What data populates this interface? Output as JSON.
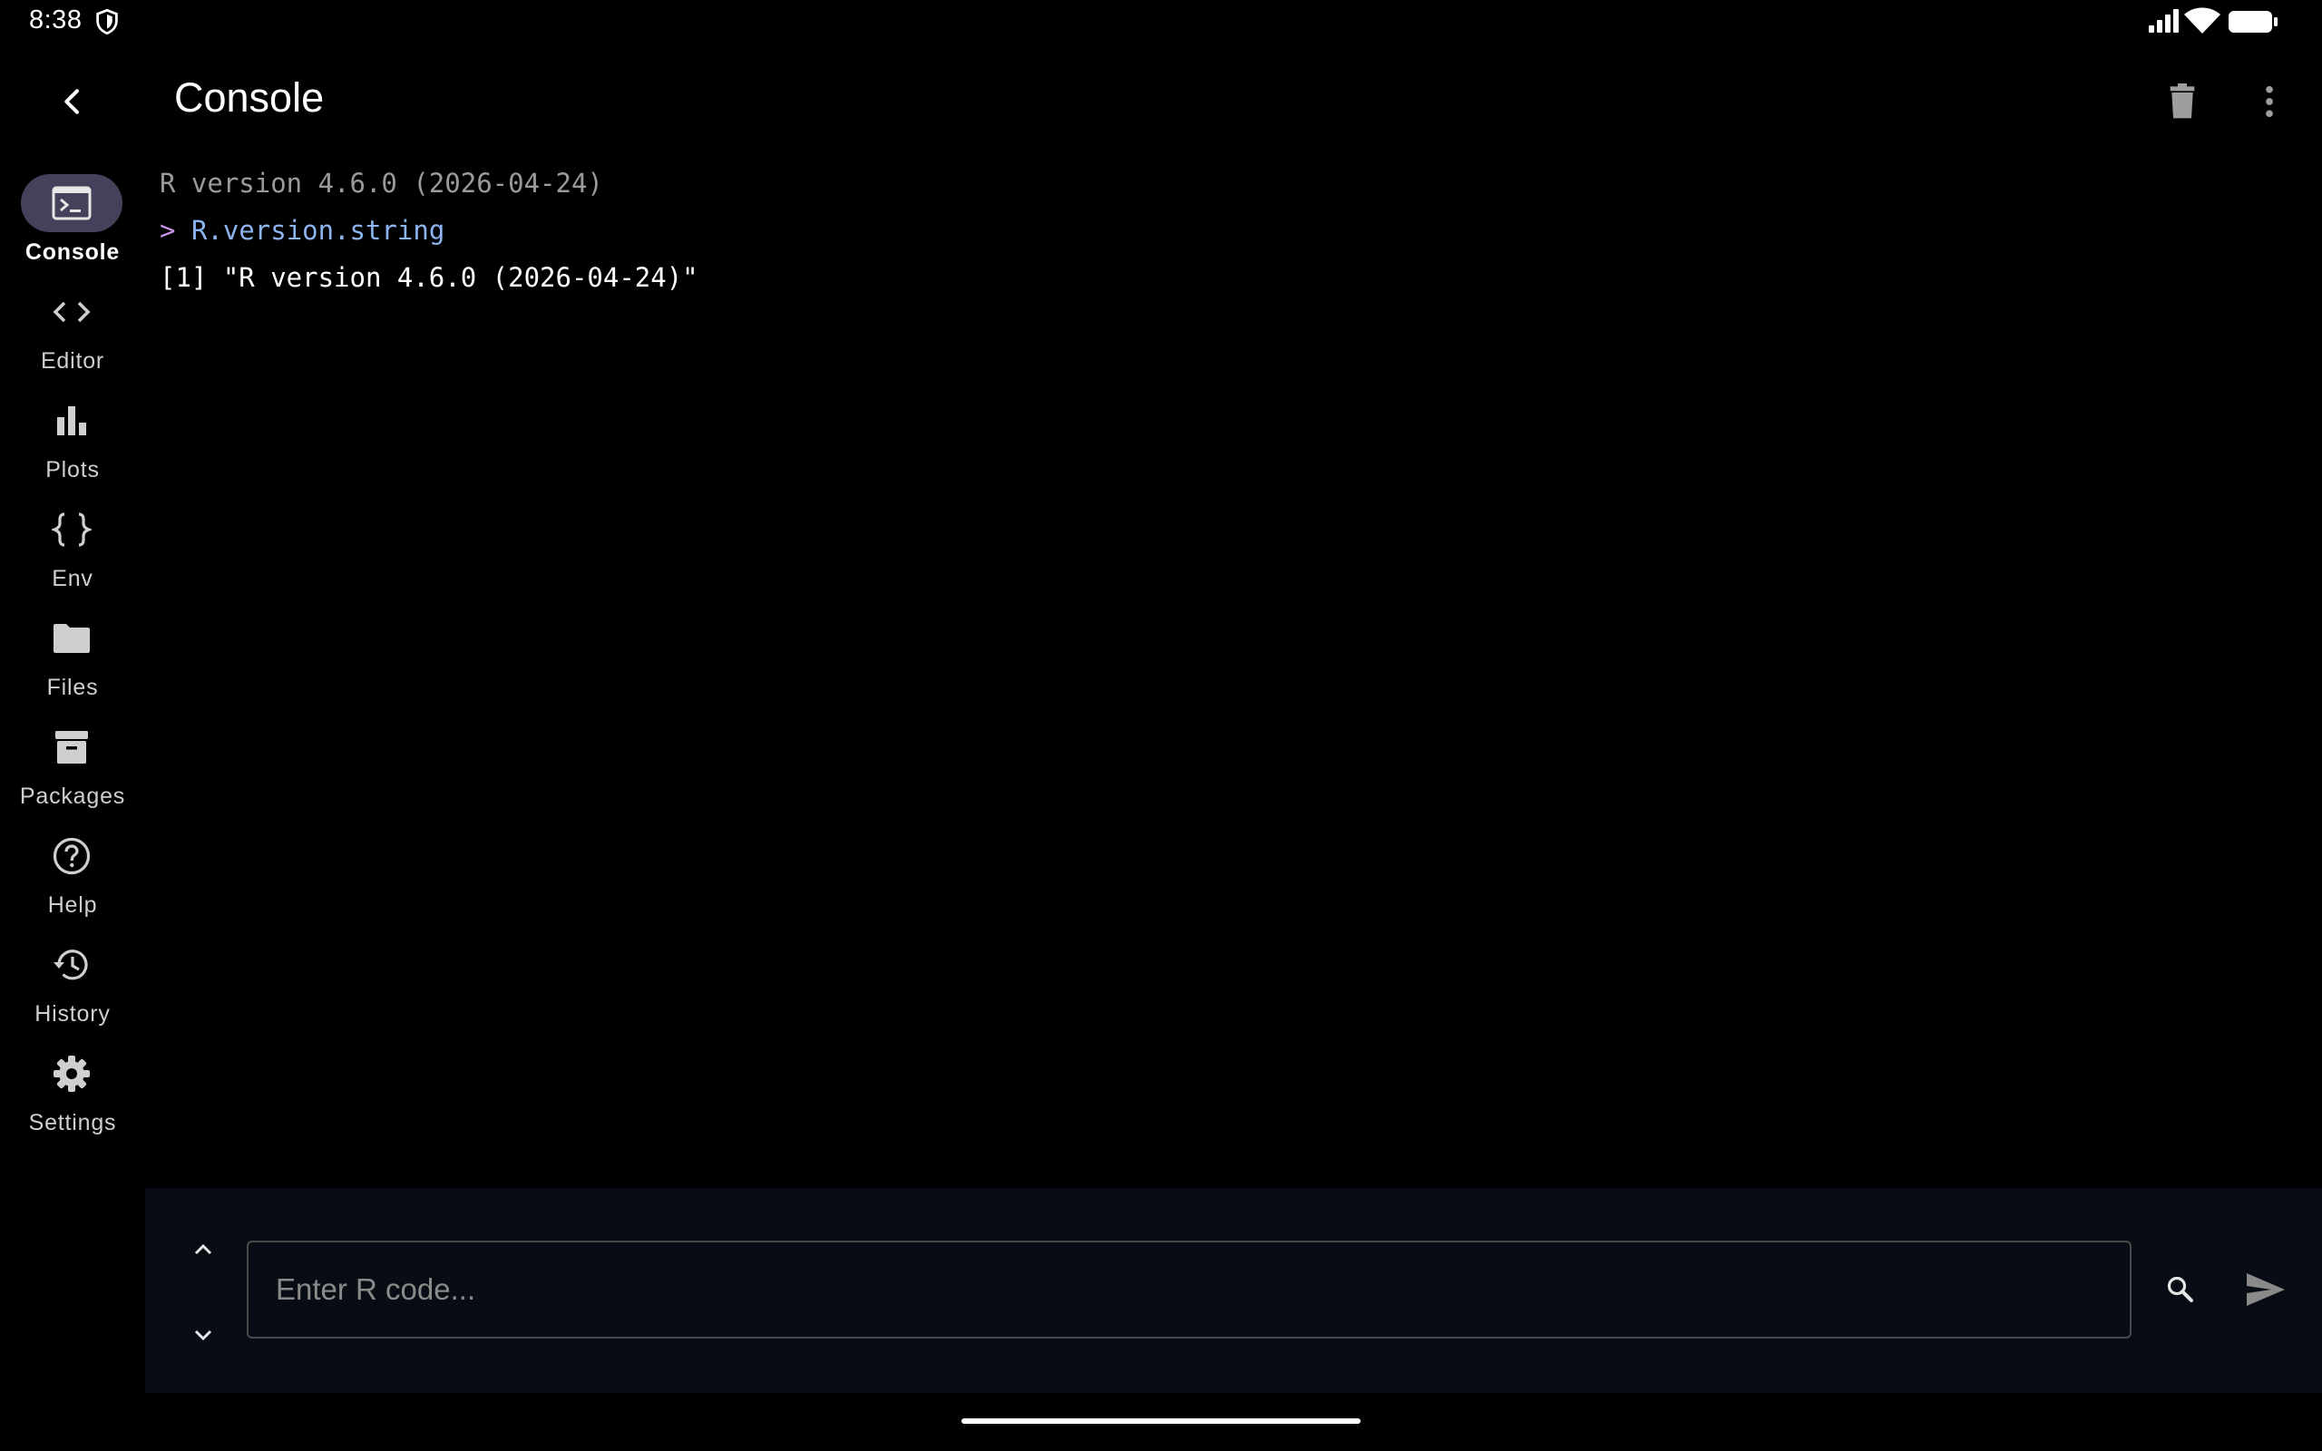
{
  "status_bar": {
    "time": "8:38",
    "icons": [
      "shield-icon",
      "signal-icon",
      "wifi-icon",
      "battery-icon"
    ]
  },
  "app_bar": {
    "title": "Console",
    "back_icon": "back-arrow-icon",
    "actions": [
      "trash-icon",
      "more-vert-icon"
    ]
  },
  "nav_rail": {
    "items": [
      {
        "label": "Console",
        "icon": "terminal-icon",
        "active": true
      },
      {
        "label": "Editor",
        "icon": "code-icon",
        "active": false
      },
      {
        "label": "Plots",
        "icon": "bar-chart-icon",
        "active": false
      },
      {
        "label": "Env",
        "icon": "braces-icon",
        "active": false
      },
      {
        "label": "Files",
        "icon": "folder-icon",
        "active": false
      },
      {
        "label": "Packages",
        "icon": "archive-icon",
        "active": false
      },
      {
        "label": "Help",
        "icon": "help-icon",
        "active": false
      },
      {
        "label": "History",
        "icon": "history-icon",
        "active": false
      },
      {
        "label": "Settings",
        "icon": "gear-icon",
        "active": false
      }
    ]
  },
  "console": {
    "banner": "R version 4.6.0 (2026-04-24)",
    "prompt": ">",
    "command": "R.version.string",
    "result": "[1] \"R version 4.6.0 (2026-04-24)\""
  },
  "input": {
    "placeholder": "Enter R code...",
    "value": ""
  },
  "colors": {
    "background": "#000000",
    "active_nav_bg": "#44425a",
    "command_text": "#8cb4f0",
    "prompt_text": "#c792ea",
    "input_bar_bg": "#080c14"
  }
}
